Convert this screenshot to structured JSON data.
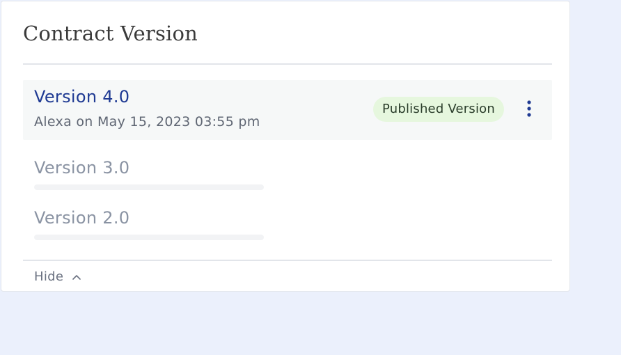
{
  "card": {
    "title": "Contract Version"
  },
  "versions": [
    {
      "name": "Version 4.0",
      "meta": "Alexa on May 15, 2023 03:55 pm",
      "status": "Published Version"
    },
    {
      "name": "Version 3.0"
    },
    {
      "name": "Version 2.0"
    }
  ],
  "footer": {
    "hide_label": "Hide"
  },
  "icons": {
    "more": "kebab-vertical-icon",
    "collapse": "chevron-up-icon"
  },
  "colors": {
    "accent": "#1f3a93",
    "badge_bg": "#e6f7de",
    "page_bg": "#ebf0fc"
  }
}
